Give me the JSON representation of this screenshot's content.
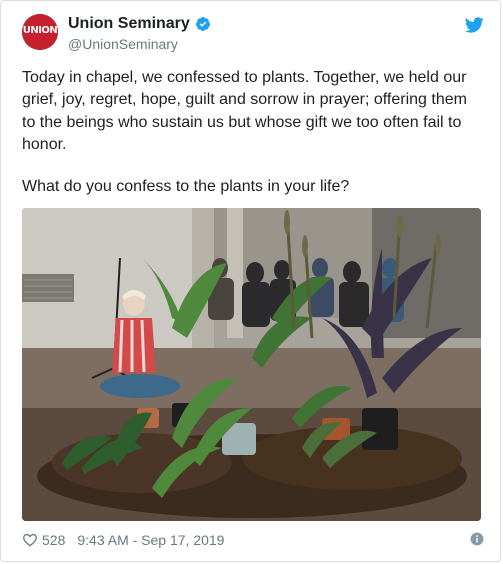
{
  "tweet": {
    "display_name": "Union Seminary",
    "handle": "@UnionSeminary",
    "avatar_text": "UNION",
    "verified": true,
    "paragraphs": [
      "Today in chapel, we confessed to plants. Together, we held our grief, joy, regret, hope, guilt and sorrow in prayer; offering them to the beings who sustain us but whose gift we too often fail to honor.",
      "What do you confess to the plants in your life?"
    ],
    "like_count": "528",
    "timestamp": "9:43 AM - Sep 17, 2019"
  },
  "icons": {
    "avatar": "union-logo",
    "verified": "verified-badge-icon",
    "brand": "twitter-bird-icon",
    "like": "heart-icon",
    "info": "info-icon"
  },
  "colors": {
    "brand_blue": "#1da1f2",
    "avatar_red": "#c61f2e",
    "text": "#1c2022",
    "muted": "#697882"
  }
}
